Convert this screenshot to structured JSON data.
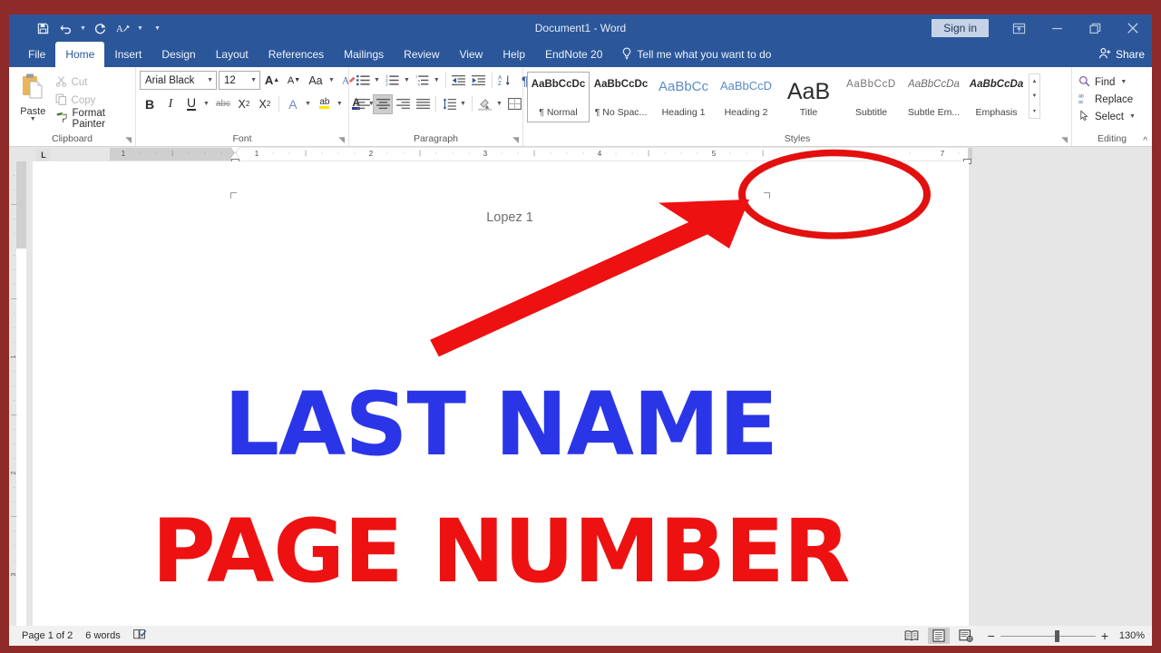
{
  "window": {
    "title": "Document1  -  Word",
    "signin_label": "Sign in",
    "quick_access": [
      {
        "name": "save-icon",
        "label": "Save"
      },
      {
        "name": "undo-icon",
        "label": "Undo"
      },
      {
        "name": "redo-icon",
        "label": "Repeat"
      },
      {
        "name": "read-aloud-icon",
        "label": "Read Aloud"
      },
      {
        "name": "customize-qat-icon",
        "label": "Customize Quick Access Toolbar"
      }
    ],
    "controls": [
      {
        "name": "ribbon-display-options-icon",
        "label": "Ribbon Display Options"
      },
      {
        "name": "minimize-icon",
        "label": "Minimize"
      },
      {
        "name": "restore-icon",
        "label": "Restore Down"
      },
      {
        "name": "close-icon",
        "label": "Close"
      }
    ]
  },
  "tabs": [
    {
      "label": "File",
      "active": false
    },
    {
      "label": "Home",
      "active": true
    },
    {
      "label": "Insert",
      "active": false
    },
    {
      "label": "Design",
      "active": false
    },
    {
      "label": "Layout",
      "active": false
    },
    {
      "label": "References",
      "active": false
    },
    {
      "label": "Mailings",
      "active": false
    },
    {
      "label": "Review",
      "active": false
    },
    {
      "label": "View",
      "active": false
    },
    {
      "label": "Help",
      "active": false
    },
    {
      "label": "EndNote 20",
      "active": false
    }
  ],
  "tell_me": "Tell me what you want to do",
  "share_label": "Share",
  "ribbon": {
    "clipboard": {
      "group_label": "Clipboard",
      "paste_label": "Paste",
      "cut_label": "Cut",
      "copy_label": "Copy",
      "format_painter_label": "Format Painter"
    },
    "font": {
      "group_label": "Font",
      "font_name": "Arial Black",
      "font_size": "12",
      "buttons": [
        {
          "name": "grow-font-icon",
          "label": "A"
        },
        {
          "name": "shrink-font-icon",
          "label": "A"
        },
        {
          "name": "change-case-icon",
          "label": "Aa"
        },
        {
          "name": "clear-formatting-icon",
          "label": "A"
        },
        {
          "name": "bold-icon",
          "label": "B"
        },
        {
          "name": "italic-icon",
          "label": "I"
        },
        {
          "name": "underline-icon",
          "label": "U"
        },
        {
          "name": "strikethrough-icon",
          "label": "abc"
        },
        {
          "name": "subscript-icon",
          "label": "X"
        },
        {
          "name": "superscript-icon",
          "label": "X"
        },
        {
          "name": "text-effects-icon",
          "label": "A"
        },
        {
          "name": "text-highlight-color-icon",
          "label": "ab"
        },
        {
          "name": "font-color-icon",
          "label": "A"
        }
      ]
    },
    "paragraph": {
      "group_label": "Paragraph",
      "buttons": [
        {
          "name": "bullets-icon",
          "label": "Bullets"
        },
        {
          "name": "numbering-icon",
          "label": "Numbering"
        },
        {
          "name": "multilevel-list-icon",
          "label": "Multilevel List"
        },
        {
          "name": "decrease-indent-icon",
          "label": "Decrease Indent"
        },
        {
          "name": "increase-indent-icon",
          "label": "Increase Indent"
        },
        {
          "name": "sort-icon",
          "label": "Sort"
        },
        {
          "name": "show-formatting-marks-icon",
          "label": "¶"
        },
        {
          "name": "align-left-icon",
          "label": "Align Left"
        },
        {
          "name": "align-center-icon",
          "label": "Center"
        },
        {
          "name": "align-right-icon",
          "label": "Align Right"
        },
        {
          "name": "justify-icon",
          "label": "Justify"
        },
        {
          "name": "line-spacing-icon",
          "label": "Line and Paragraph Spacing"
        },
        {
          "name": "shading-icon",
          "label": "Shading"
        },
        {
          "name": "borders-icon",
          "label": "Borders"
        }
      ],
      "active_alignment": "align-center-icon"
    },
    "styles": {
      "group_label": "Styles",
      "items": [
        {
          "preview": "AaBbCcDc",
          "name": "¶ Normal",
          "selected": true,
          "kind": "normal"
        },
        {
          "preview": "AaBbCcDc",
          "name": "¶ No Spac...",
          "selected": false,
          "kind": "normal"
        },
        {
          "preview": "AaBbCc",
          "name": "Heading 1",
          "selected": false,
          "kind": "heading1"
        },
        {
          "preview": "AaBbCcD",
          "name": "Heading 2",
          "selected": false,
          "kind": "heading2"
        },
        {
          "preview": "AaB",
          "name": "Title",
          "selected": false,
          "kind": "title"
        },
        {
          "preview": "AaBbCcD",
          "name": "Subtitle",
          "selected": false,
          "kind": "subtitle"
        },
        {
          "preview": "AaBbCcDa",
          "name": "Subtle Em...",
          "selected": false,
          "kind": "subtle"
        },
        {
          "preview": "AaBbCcDa",
          "name": "Emphasis",
          "selected": false,
          "kind": "emphasis"
        }
      ]
    },
    "editing": {
      "group_label": "Editing",
      "find_label": "Find",
      "replace_label": "Replace",
      "select_label": "Select"
    }
  },
  "ruler": {
    "tab_stop": "L",
    "h_numbers": [
      "1",
      "1",
      "2",
      "3",
      "4",
      "5",
      "7"
    ]
  },
  "document": {
    "header_text": "Lopez 1"
  },
  "annotations": {
    "blue_text": "LAST NAME",
    "red_text": "PAGE NUMBER",
    "blue_color": "#2b35e8",
    "red_color": "#ee1111",
    "circle_color": "#e31010",
    "arrow_color": "#ee1111"
  },
  "status": {
    "page_label": "Page 1 of 2",
    "words_label": "6 words",
    "proofing_icon": "proofing-errors-icon",
    "views": [
      {
        "name": "read-mode-icon",
        "label": "Read Mode",
        "active": false
      },
      {
        "name": "print-layout-icon",
        "label": "Print Layout",
        "active": true
      },
      {
        "name": "web-layout-icon",
        "label": "Web Layout",
        "active": false
      }
    ],
    "zoom_out": "−",
    "zoom_in": "+",
    "zoom_level": "130%"
  }
}
